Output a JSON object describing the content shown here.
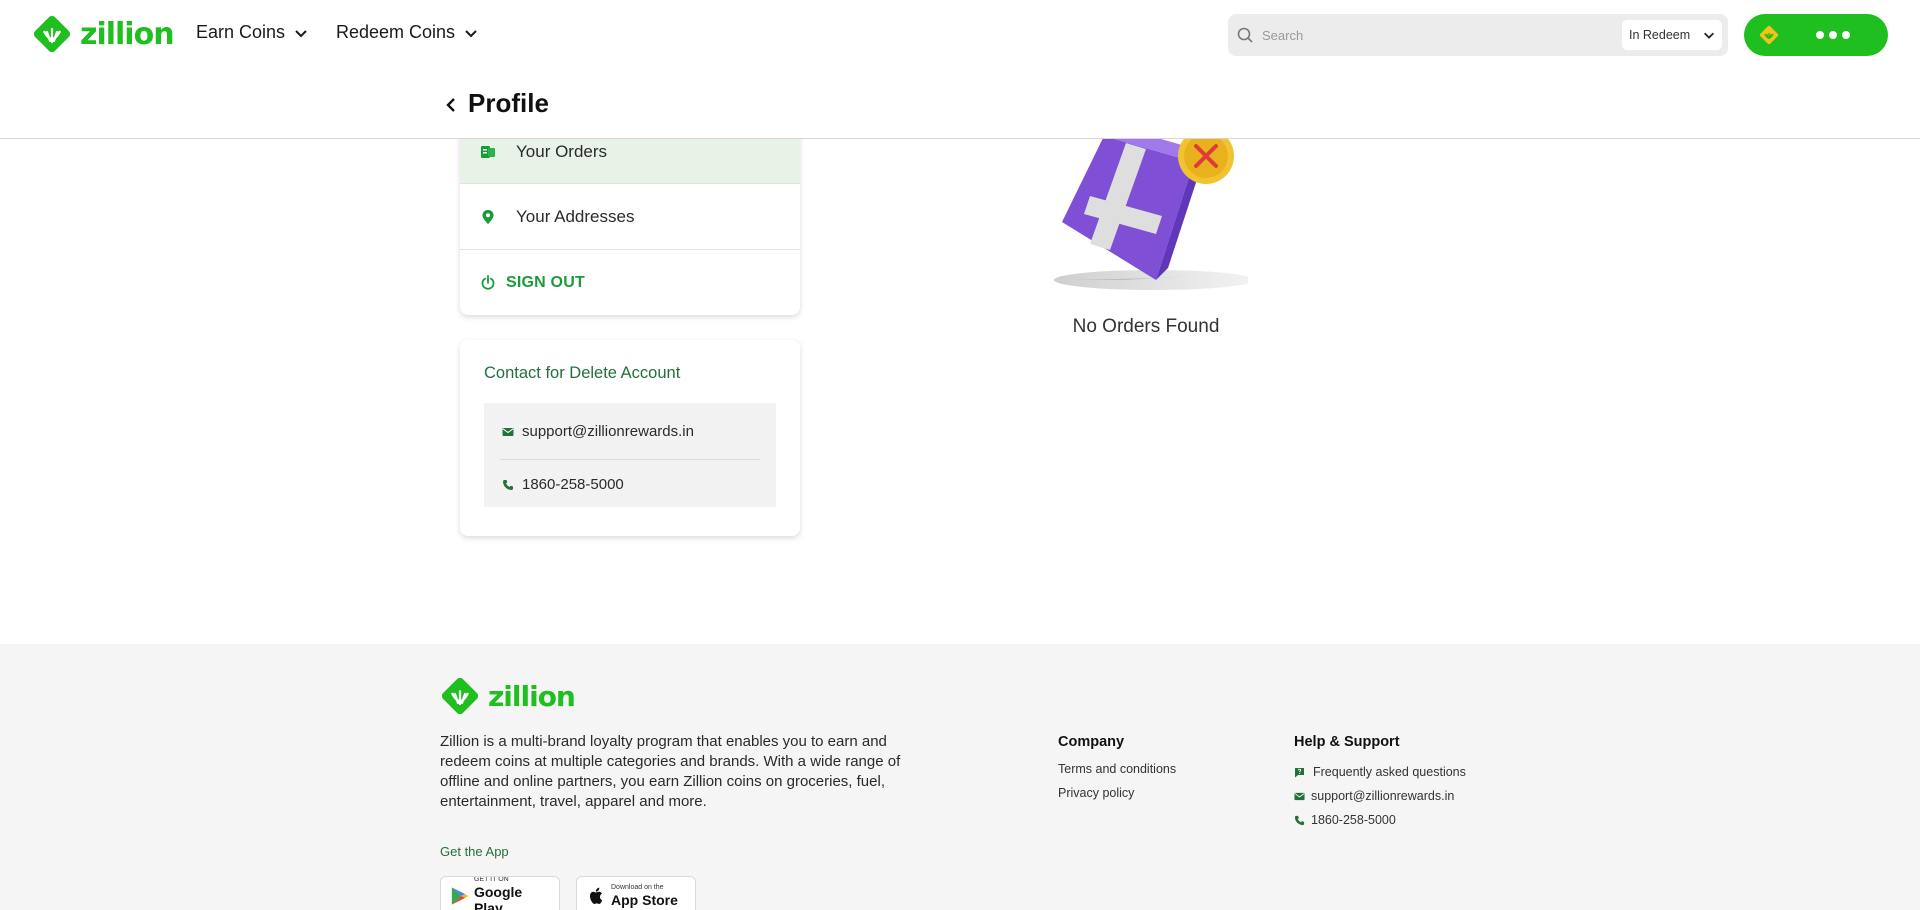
{
  "brand": {
    "name": "zillion",
    "accent_color": "#1fbf1f",
    "dark_green": "#1a9b3a"
  },
  "topnav": {
    "earn_label": "Earn Coins",
    "redeem_label": "Redeem Coins",
    "search_placeholder": "Search",
    "search_value": "",
    "search_scope": "In Redeem",
    "coin_badge_icon": "zillion-coin-icon",
    "more_icon": "more-dots-icon"
  },
  "profile": {
    "title": "Profile",
    "menu": [
      {
        "label": "Your Orders",
        "icon": "orders-icon",
        "active": true
      },
      {
        "label": "Your Addresses",
        "icon": "location-pin-icon",
        "active": false
      },
      {
        "label": "SIGN OUT",
        "icon": "power-icon",
        "active": false
      }
    ],
    "contact": {
      "title": "Contact for Delete Account",
      "email": "support@zillionrewards.in",
      "phone": "1860-258-5000"
    }
  },
  "orders": {
    "empty_message": "No Orders Found",
    "illustration": "empty-box-icon"
  },
  "footer": {
    "about": "Zillion is a multi-brand loyalty program that enables you to earn and redeem coins at multiple categories and brands. With a wide range of offline and online partners, you earn Zillion coins on groceries, fuel, entertainment, travel, apparel and more.",
    "get_app": "Get the App",
    "google_play": {
      "small": "GET IT ON",
      "big": "Google Play"
    },
    "app_store": {
      "small": "Download on the",
      "big": "App Store"
    },
    "company": {
      "title": "Company",
      "links": [
        "Terms and conditions",
        "Privacy policy"
      ]
    },
    "help": {
      "title": "Help & Support",
      "faq": "Frequently asked questions",
      "email": "support@zillionrewards.in",
      "phone": "1860-258-5000"
    }
  }
}
